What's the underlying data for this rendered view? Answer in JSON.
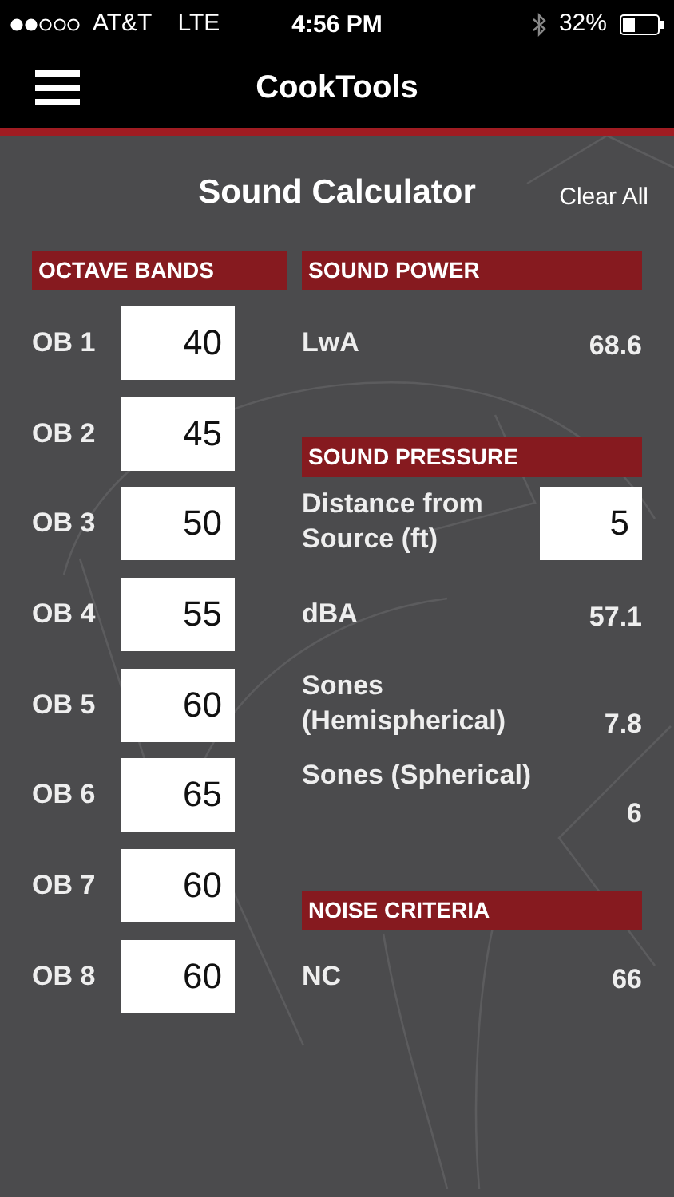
{
  "status_bar": {
    "carrier": "AT&T",
    "network": "LTE",
    "time": "4:56 PM",
    "battery": "32%"
  },
  "nav": {
    "title": "CookTools"
  },
  "page": {
    "title": "Sound Calculator",
    "action": "Clear All"
  },
  "octave_bands": {
    "header": "OCTAVE BANDS",
    "bands": [
      {
        "label": "OB 1",
        "value": "40"
      },
      {
        "label": "OB 2",
        "value": "45"
      },
      {
        "label": "OB 3",
        "value": "50"
      },
      {
        "label": "OB 4",
        "value": "55"
      },
      {
        "label": "OB 5",
        "value": "60"
      },
      {
        "label": "OB 6",
        "value": "65"
      },
      {
        "label": "OB 7",
        "value": "60"
      },
      {
        "label": "OB 8",
        "value": "60"
      }
    ]
  },
  "results": [
    {
      "kind": "header",
      "text": "SOUND POWER"
    },
    {
      "kind": "reading",
      "label": "LwA",
      "value": "68.6"
    },
    {
      "kind": "header",
      "text": "SOUND PRESSURE"
    },
    {
      "kind": "input",
      "label": "Distance from Source (ft)",
      "value": "5"
    },
    {
      "kind": "reading",
      "label": "dBA",
      "value": "57.1"
    },
    {
      "kind": "reading",
      "label": "Sones (Hemispherical)",
      "value": "7.8"
    },
    {
      "kind": "reading",
      "label": "Sones (Spherical)",
      "value": "6"
    },
    {
      "kind": "header",
      "text": "NOISE CRITERIA"
    },
    {
      "kind": "reading",
      "label": "NC",
      "value": "66"
    }
  ]
}
